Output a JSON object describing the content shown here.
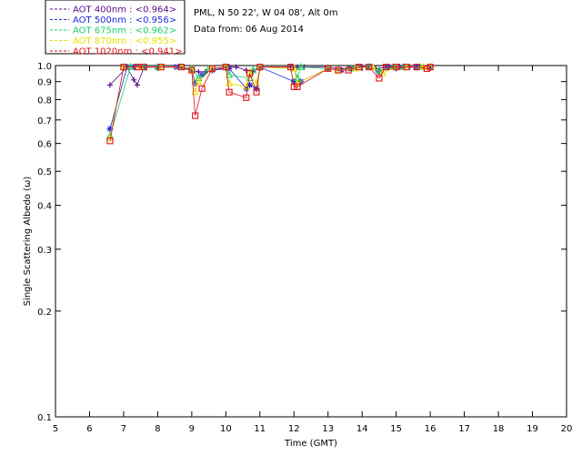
{
  "header": {
    "site": "PML, N 50 22', W 04 08', Alt 0m",
    "date": "Data from: 06 Aug 2014"
  },
  "legend": [
    {
      "label": "AOT  400nm : <0.964>",
      "color": "#5a0a8c"
    },
    {
      "label": "AOT  500nm : <0.956>",
      "color": "#1f2bd6"
    },
    {
      "label": "AOT  675nm : <0.962>",
      "color": "#18d26a"
    },
    {
      "label": "AOT  870nm : <0.955>",
      "color": "#e8e000"
    },
    {
      "label": "AOT 1020nm : <0.941>",
      "color": "#e0101a"
    }
  ],
  "chart_data": {
    "type": "scatter",
    "xlabel": "Time (GMT)",
    "ylabel": "Single Scattering Albedo (ω)",
    "xlim": [
      5,
      20
    ],
    "ylim": [
      0.1,
      1.0
    ],
    "yscale": "log",
    "xticks": [
      5,
      6,
      7,
      8,
      9,
      10,
      11,
      12,
      13,
      14,
      15,
      16,
      17,
      18,
      19,
      20
    ],
    "yticks": [
      0.1,
      0.2,
      0.3,
      0.4,
      0.5,
      0.6,
      0.7,
      0.8,
      0.9,
      1.0
    ],
    "ytick_labels": [
      "0.1",
      "0.2",
      "0.3",
      "0.4",
      "0.5",
      "0.6",
      "0.7",
      "0.8",
      "0.9",
      "1.0"
    ],
    "series": [
      {
        "name": "AOT  400nm : <0.964>",
        "marker": "plus",
        "color": "#5a0a8c",
        "x": [
          6.6,
          7.1,
          7.3,
          7.4,
          7.6,
          8.0,
          8.5,
          9.0,
          9.2,
          9.4,
          9.6,
          10.1,
          10.3,
          10.6,
          10.8,
          11.0,
          11.9,
          12.1,
          12.3,
          13.0,
          13.3,
          13.6,
          14.0,
          14.4,
          14.7,
          15.0,
          15.4,
          15.8,
          16.0
        ],
        "y": [
          0.88,
          0.99,
          0.91,
          0.88,
          0.99,
          0.99,
          0.99,
          0.97,
          0.96,
          0.96,
          0.97,
          0.99,
          0.99,
          0.97,
          0.96,
          0.99,
          0.99,
          0.99,
          0.99,
          0.99,
          0.98,
          0.98,
          0.99,
          0.98,
          0.99,
          0.98,
          0.99,
          0.99,
          0.99
        ]
      },
      {
        "name": "AOT  500nm : <0.956>",
        "marker": "star",
        "color": "#1f2bd6",
        "x": [
          6.6,
          7.1,
          7.3,
          7.6,
          8.0,
          8.6,
          9.0,
          9.1,
          9.3,
          9.6,
          10.1,
          10.6,
          10.7,
          10.9,
          11.0,
          12.0,
          12.2,
          13.0,
          13.4,
          13.7,
          14.2,
          14.5,
          14.8,
          15.1,
          15.6,
          16.0
        ],
        "y": [
          0.66,
          0.99,
          0.99,
          0.99,
          0.99,
          0.99,
          0.97,
          0.89,
          0.94,
          0.97,
          0.98,
          0.86,
          0.88,
          0.86,
          0.99,
          0.9,
          0.9,
          0.98,
          0.97,
          0.98,
          0.99,
          0.96,
          0.99,
          0.99,
          0.99,
          0.99
        ]
      },
      {
        "name": "AOT  675nm : <0.962>",
        "marker": "triangle",
        "color": "#18d26a",
        "x": [
          6.6,
          7.2,
          7.6,
          8.0,
          8.7,
          9.0,
          9.2,
          9.5,
          10.0,
          10.1,
          10.7,
          10.8,
          11.0,
          12.0,
          12.1,
          12.2,
          13.0,
          13.3,
          13.7,
          14.2,
          14.5,
          14.9,
          15.2,
          15.7,
          16.0
        ],
        "y": [
          0.63,
          0.99,
          0.99,
          0.99,
          0.99,
          0.98,
          0.92,
          0.98,
          0.99,
          0.94,
          0.92,
          0.97,
          0.99,
          0.98,
          0.92,
          0.99,
          0.98,
          0.97,
          0.98,
          0.99,
          0.97,
          0.99,
          0.99,
          0.99,
          0.99
        ]
      },
      {
        "name": "AOT  870nm : <0.955>",
        "marker": "triangle",
        "color": "#e8e000",
        "x": [
          6.6,
          7.0,
          7.5,
          8.1,
          8.7,
          9.0,
          9.1,
          9.2,
          9.6,
          10.0,
          10.1,
          10.6,
          10.7,
          10.9,
          11.0,
          12.0,
          12.1,
          13.0,
          13.3,
          13.8,
          14.3,
          14.6,
          15.0,
          15.3,
          15.8,
          16.0
        ],
        "y": [
          0.62,
          0.99,
          0.99,
          0.99,
          0.99,
          0.97,
          0.84,
          0.9,
          0.98,
          0.99,
          0.89,
          0.87,
          0.96,
          0.89,
          0.99,
          0.98,
          0.89,
          0.98,
          0.97,
          0.98,
          0.99,
          0.95,
          0.99,
          0.99,
          0.99,
          0.99
        ]
      },
      {
        "name": "AOT 1020nm : <0.941>",
        "marker": "square",
        "color": "#e0101a",
        "x": [
          6.6,
          7.0,
          7.4,
          7.6,
          8.1,
          8.7,
          9.0,
          9.1,
          9.3,
          9.6,
          10.0,
          10.1,
          10.6,
          10.7,
          10.9,
          11.0,
          11.9,
          12.0,
          12.1,
          13.0,
          13.3,
          13.6,
          13.9,
          14.2,
          14.5,
          14.7,
          15.0,
          15.3,
          15.6,
          15.9,
          16.0
        ],
        "y": [
          0.61,
          0.99,
          0.99,
          0.99,
          0.99,
          0.99,
          0.97,
          0.72,
          0.86,
          0.98,
          0.99,
          0.84,
          0.81,
          0.95,
          0.84,
          0.99,
          0.99,
          0.87,
          0.87,
          0.98,
          0.97,
          0.97,
          0.99,
          0.99,
          0.92,
          0.99,
          0.99,
          0.99,
          0.99,
          0.98,
          0.99
        ]
      }
    ]
  }
}
